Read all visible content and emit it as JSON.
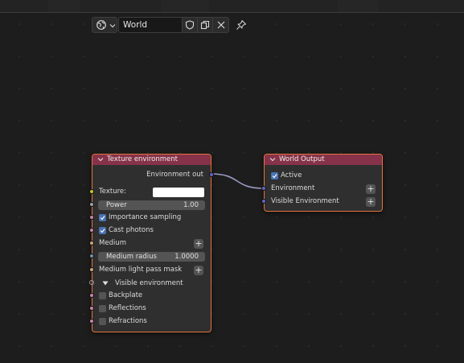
{
  "header": {
    "world_name": "World",
    "world_icon": "globe-icon",
    "fake_user_icon": "shield-icon",
    "duplicate_icon": "copy-icon",
    "unlink_icon": "close-icon",
    "pin_icon": "pin-icon"
  },
  "texture_node": {
    "title": "Texture environment",
    "output_label": "Environment out",
    "texture_label": "Texture:",
    "power_label": "Power",
    "power_value": "1.00",
    "importance_sampling_label": "Importance sampling",
    "importance_sampling_checked": true,
    "cast_photons_label": "Cast photons",
    "cast_photons_checked": true,
    "medium_label": "Medium",
    "medium_radius_label": "Medium radius",
    "medium_radius_value": "1.0000",
    "medium_light_pass_mask_label": "Medium light pass mask",
    "visible_environment_label": "Visible environment",
    "backplate_label": "Backplate",
    "reflections_label": "Reflections",
    "refractions_label": "Refractions"
  },
  "output_node": {
    "title": "World Output",
    "active_label": "Active",
    "active_checked": true,
    "environment_label": "Environment",
    "visible_environment_label": "Visible Environment"
  },
  "colors": {
    "node_header": "#86324a",
    "node_border_selected": "#e3733a",
    "checkbox_on": "#4772b3",
    "link": "#9a9ac4"
  }
}
